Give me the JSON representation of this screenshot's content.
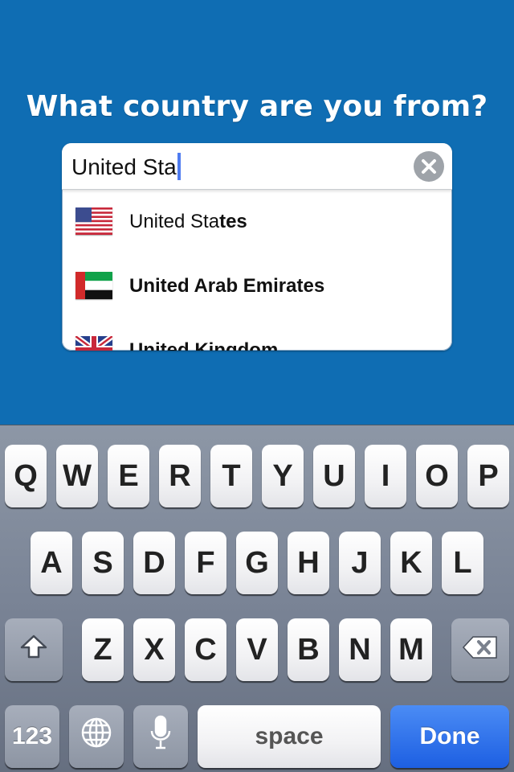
{
  "prompt": {
    "question": "What country are you from?"
  },
  "search": {
    "value": "United Sta",
    "clear_icon": "clear-x-icon"
  },
  "suggestions": [
    {
      "prefix": "United Sta",
      "rest": "tes",
      "flag": "us-flag-icon"
    },
    {
      "prefix": "",
      "rest": "United Arab Emirates",
      "flag": "uae-flag-icon"
    },
    {
      "prefix": "",
      "rest": "United Kingdom",
      "flag": "uk-flag-icon"
    }
  ],
  "keyboard": {
    "row1": [
      "Q",
      "W",
      "E",
      "R",
      "T",
      "Y",
      "U",
      "I",
      "O",
      "P"
    ],
    "row2": [
      "A",
      "S",
      "D",
      "F",
      "G",
      "H",
      "J",
      "K",
      "L"
    ],
    "row3": [
      "Z",
      "X",
      "C",
      "V",
      "B",
      "N",
      "M"
    ],
    "numbers_label": "123",
    "space_label": "space",
    "done_label": "Done",
    "shift_icon": "shift-icon",
    "delete_icon": "backspace-icon",
    "globe_icon": "globe-icon",
    "mic_icon": "microphone-icon"
  },
  "colors": {
    "background": "#0f6db3",
    "done_key": "#1d5fe2",
    "caret": "#4f7cf0"
  }
}
